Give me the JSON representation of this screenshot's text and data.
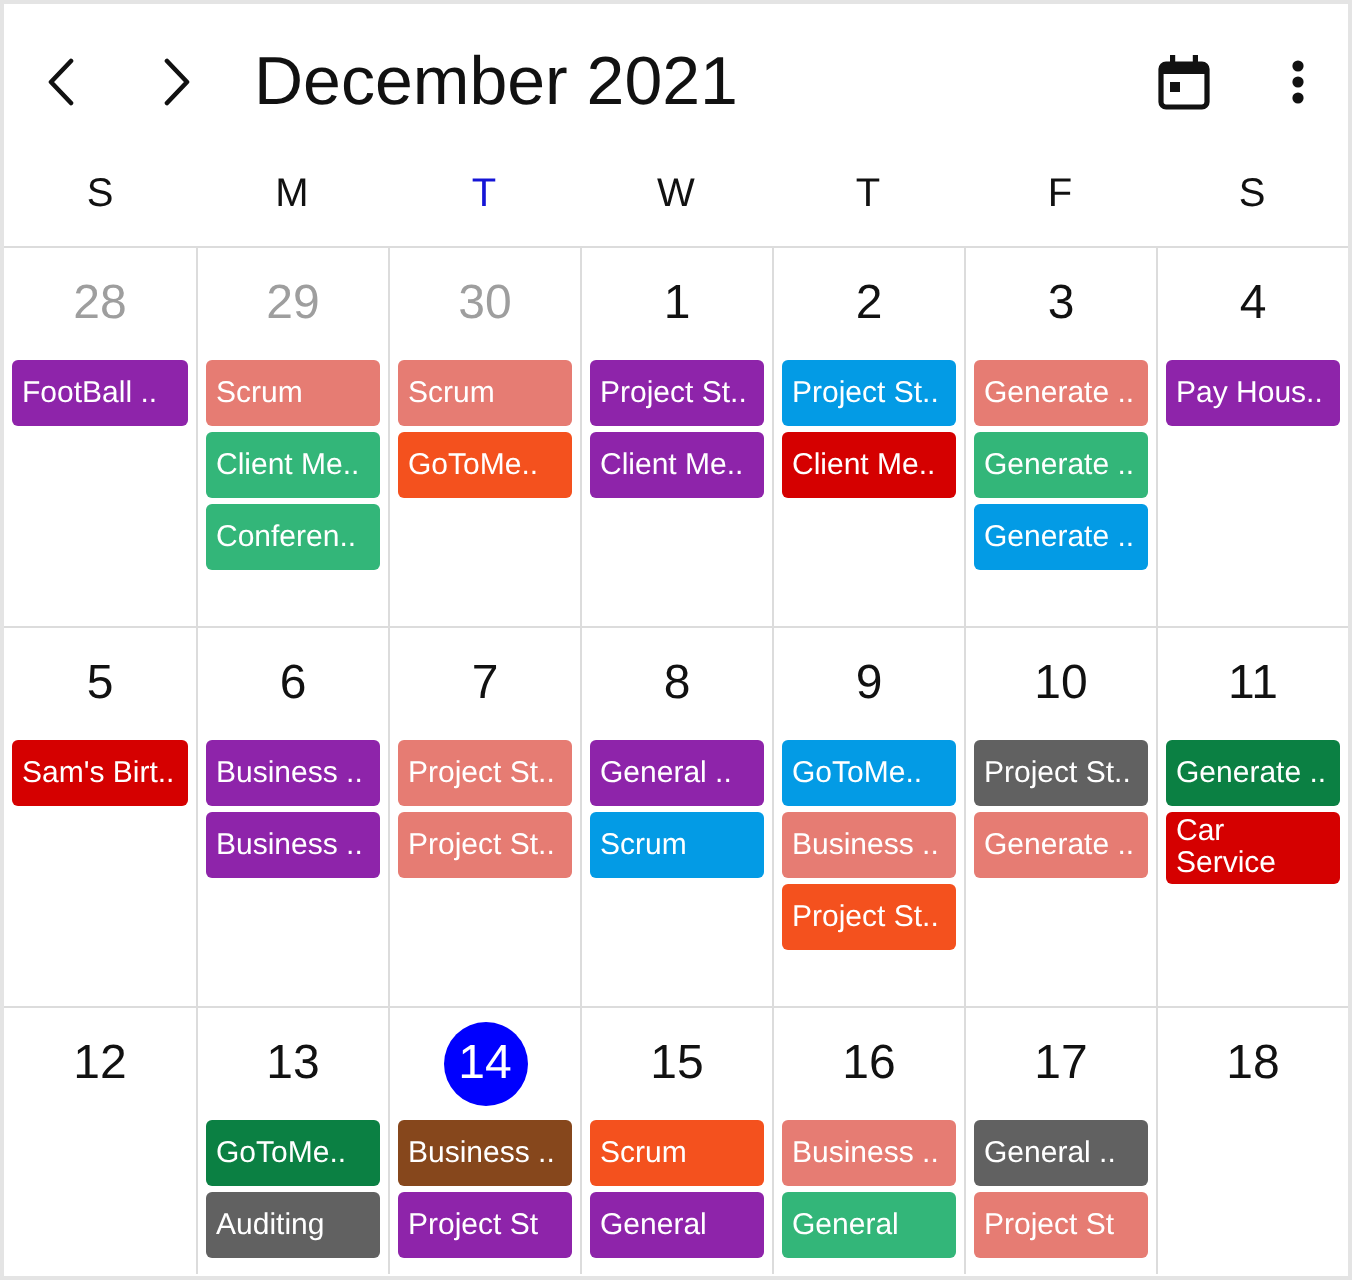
{
  "header": {
    "title": "December 2021"
  },
  "weekdays": [
    {
      "label": "S",
      "selected": false
    },
    {
      "label": "M",
      "selected": false
    },
    {
      "label": "T",
      "selected": true
    },
    {
      "label": "W",
      "selected": false
    },
    {
      "label": "T",
      "selected": false
    },
    {
      "label": "F",
      "selected": false
    },
    {
      "label": "S",
      "selected": false
    }
  ],
  "weeks": [
    {
      "days": [
        {
          "date": "28",
          "other_month": true,
          "today": false,
          "events": [
            {
              "title": "FootBall ..",
              "color": "#8e24aa"
            }
          ]
        },
        {
          "date": "29",
          "other_month": true,
          "today": false,
          "events": [
            {
              "title": "Scrum",
              "color": "#e67c73"
            },
            {
              "title": "Client Me..",
              "color": "#33b679"
            },
            {
              "title": "Conferen..",
              "color": "#33b679"
            }
          ]
        },
        {
          "date": "30",
          "other_month": true,
          "today": false,
          "events": [
            {
              "title": "Scrum",
              "color": "#e67c73"
            },
            {
              "title": "GoToMe..",
              "color": "#f4511e"
            }
          ]
        },
        {
          "date": "1",
          "other_month": false,
          "today": false,
          "events": [
            {
              "title": "Project St..",
              "color": "#8e24aa"
            },
            {
              "title": "Client Me..",
              "color": "#8e24aa"
            }
          ]
        },
        {
          "date": "2",
          "other_month": false,
          "today": false,
          "events": [
            {
              "title": "Project St..",
              "color": "#039be5"
            },
            {
              "title": "Client Me..",
              "color": "#d50000"
            }
          ]
        },
        {
          "date": "3",
          "other_month": false,
          "today": false,
          "events": [
            {
              "title": "Generate ..",
              "color": "#e67c73"
            },
            {
              "title": "Generate ..",
              "color": "#33b679"
            },
            {
              "title": "Generate ..",
              "color": "#039be5"
            }
          ]
        },
        {
          "date": "4",
          "other_month": false,
          "today": false,
          "events": [
            {
              "title": "Pay Hous..",
              "color": "#8e24aa"
            }
          ]
        }
      ]
    },
    {
      "days": [
        {
          "date": "5",
          "other_month": false,
          "today": false,
          "events": [
            {
              "title": "Sam's Birt..",
              "color": "#d50000"
            }
          ]
        },
        {
          "date": "6",
          "other_month": false,
          "today": false,
          "events": [
            {
              "title": "Business ..",
              "color": "#8e24aa"
            },
            {
              "title": "Business ..",
              "color": "#8e24aa"
            }
          ]
        },
        {
          "date": "7",
          "other_month": false,
          "today": false,
          "events": [
            {
              "title": "Project St..",
              "color": "#e67c73"
            },
            {
              "title": "Project St..",
              "color": "#e67c73"
            }
          ]
        },
        {
          "date": "8",
          "other_month": false,
          "today": false,
          "events": [
            {
              "title": "General ..",
              "color": "#8e24aa"
            },
            {
              "title": "Scrum",
              "color": "#039be5"
            }
          ]
        },
        {
          "date": "9",
          "other_month": false,
          "today": false,
          "events": [
            {
              "title": "GoToMe..",
              "color": "#039be5"
            },
            {
              "title": "Business ..",
              "color": "#e67c73"
            },
            {
              "title": "Project St..",
              "color": "#f4511e"
            }
          ]
        },
        {
          "date": "10",
          "other_month": false,
          "today": false,
          "events": [
            {
              "title": "Project St..",
              "color": "#616161"
            },
            {
              "title": "Generate ..",
              "color": "#e67c73"
            }
          ]
        },
        {
          "date": "11",
          "other_month": false,
          "today": false,
          "events": [
            {
              "title": "Generate ..",
              "color": "#0b8043"
            },
            {
              "title": "Car Service",
              "color": "#d50000"
            }
          ]
        }
      ]
    },
    {
      "days": [
        {
          "date": "12",
          "other_month": false,
          "today": false
        },
        {
          "date": "13",
          "other_month": false,
          "today": false,
          "events": [
            {
              "title": "GoToMe..",
              "color": "#0b8043"
            },
            {
              "title": "Auditing",
              "color": "#616161"
            }
          ]
        },
        {
          "date": "14",
          "other_month": false,
          "today": true,
          "events": [
            {
              "title": "Business ..",
              "color": "#86471c"
            },
            {
              "title": "Project St",
              "color": "#8e24aa"
            }
          ]
        },
        {
          "date": "15",
          "other_month": false,
          "today": false,
          "events": [
            {
              "title": "Scrum",
              "color": "#f4511e"
            },
            {
              "title": "General",
              "color": "#8e24aa"
            }
          ]
        },
        {
          "date": "16",
          "other_month": false,
          "today": false,
          "events": [
            {
              "title": "Business ..",
              "color": "#e67c73"
            },
            {
              "title": "General",
              "color": "#33b679"
            }
          ]
        },
        {
          "date": "17",
          "other_month": false,
          "today": false,
          "events": [
            {
              "title": "General ..",
              "color": "#616161"
            },
            {
              "title": "Project St",
              "color": "#e67c73"
            }
          ]
        },
        {
          "date": "18",
          "other_month": false,
          "today": false
        }
      ]
    }
  ]
}
